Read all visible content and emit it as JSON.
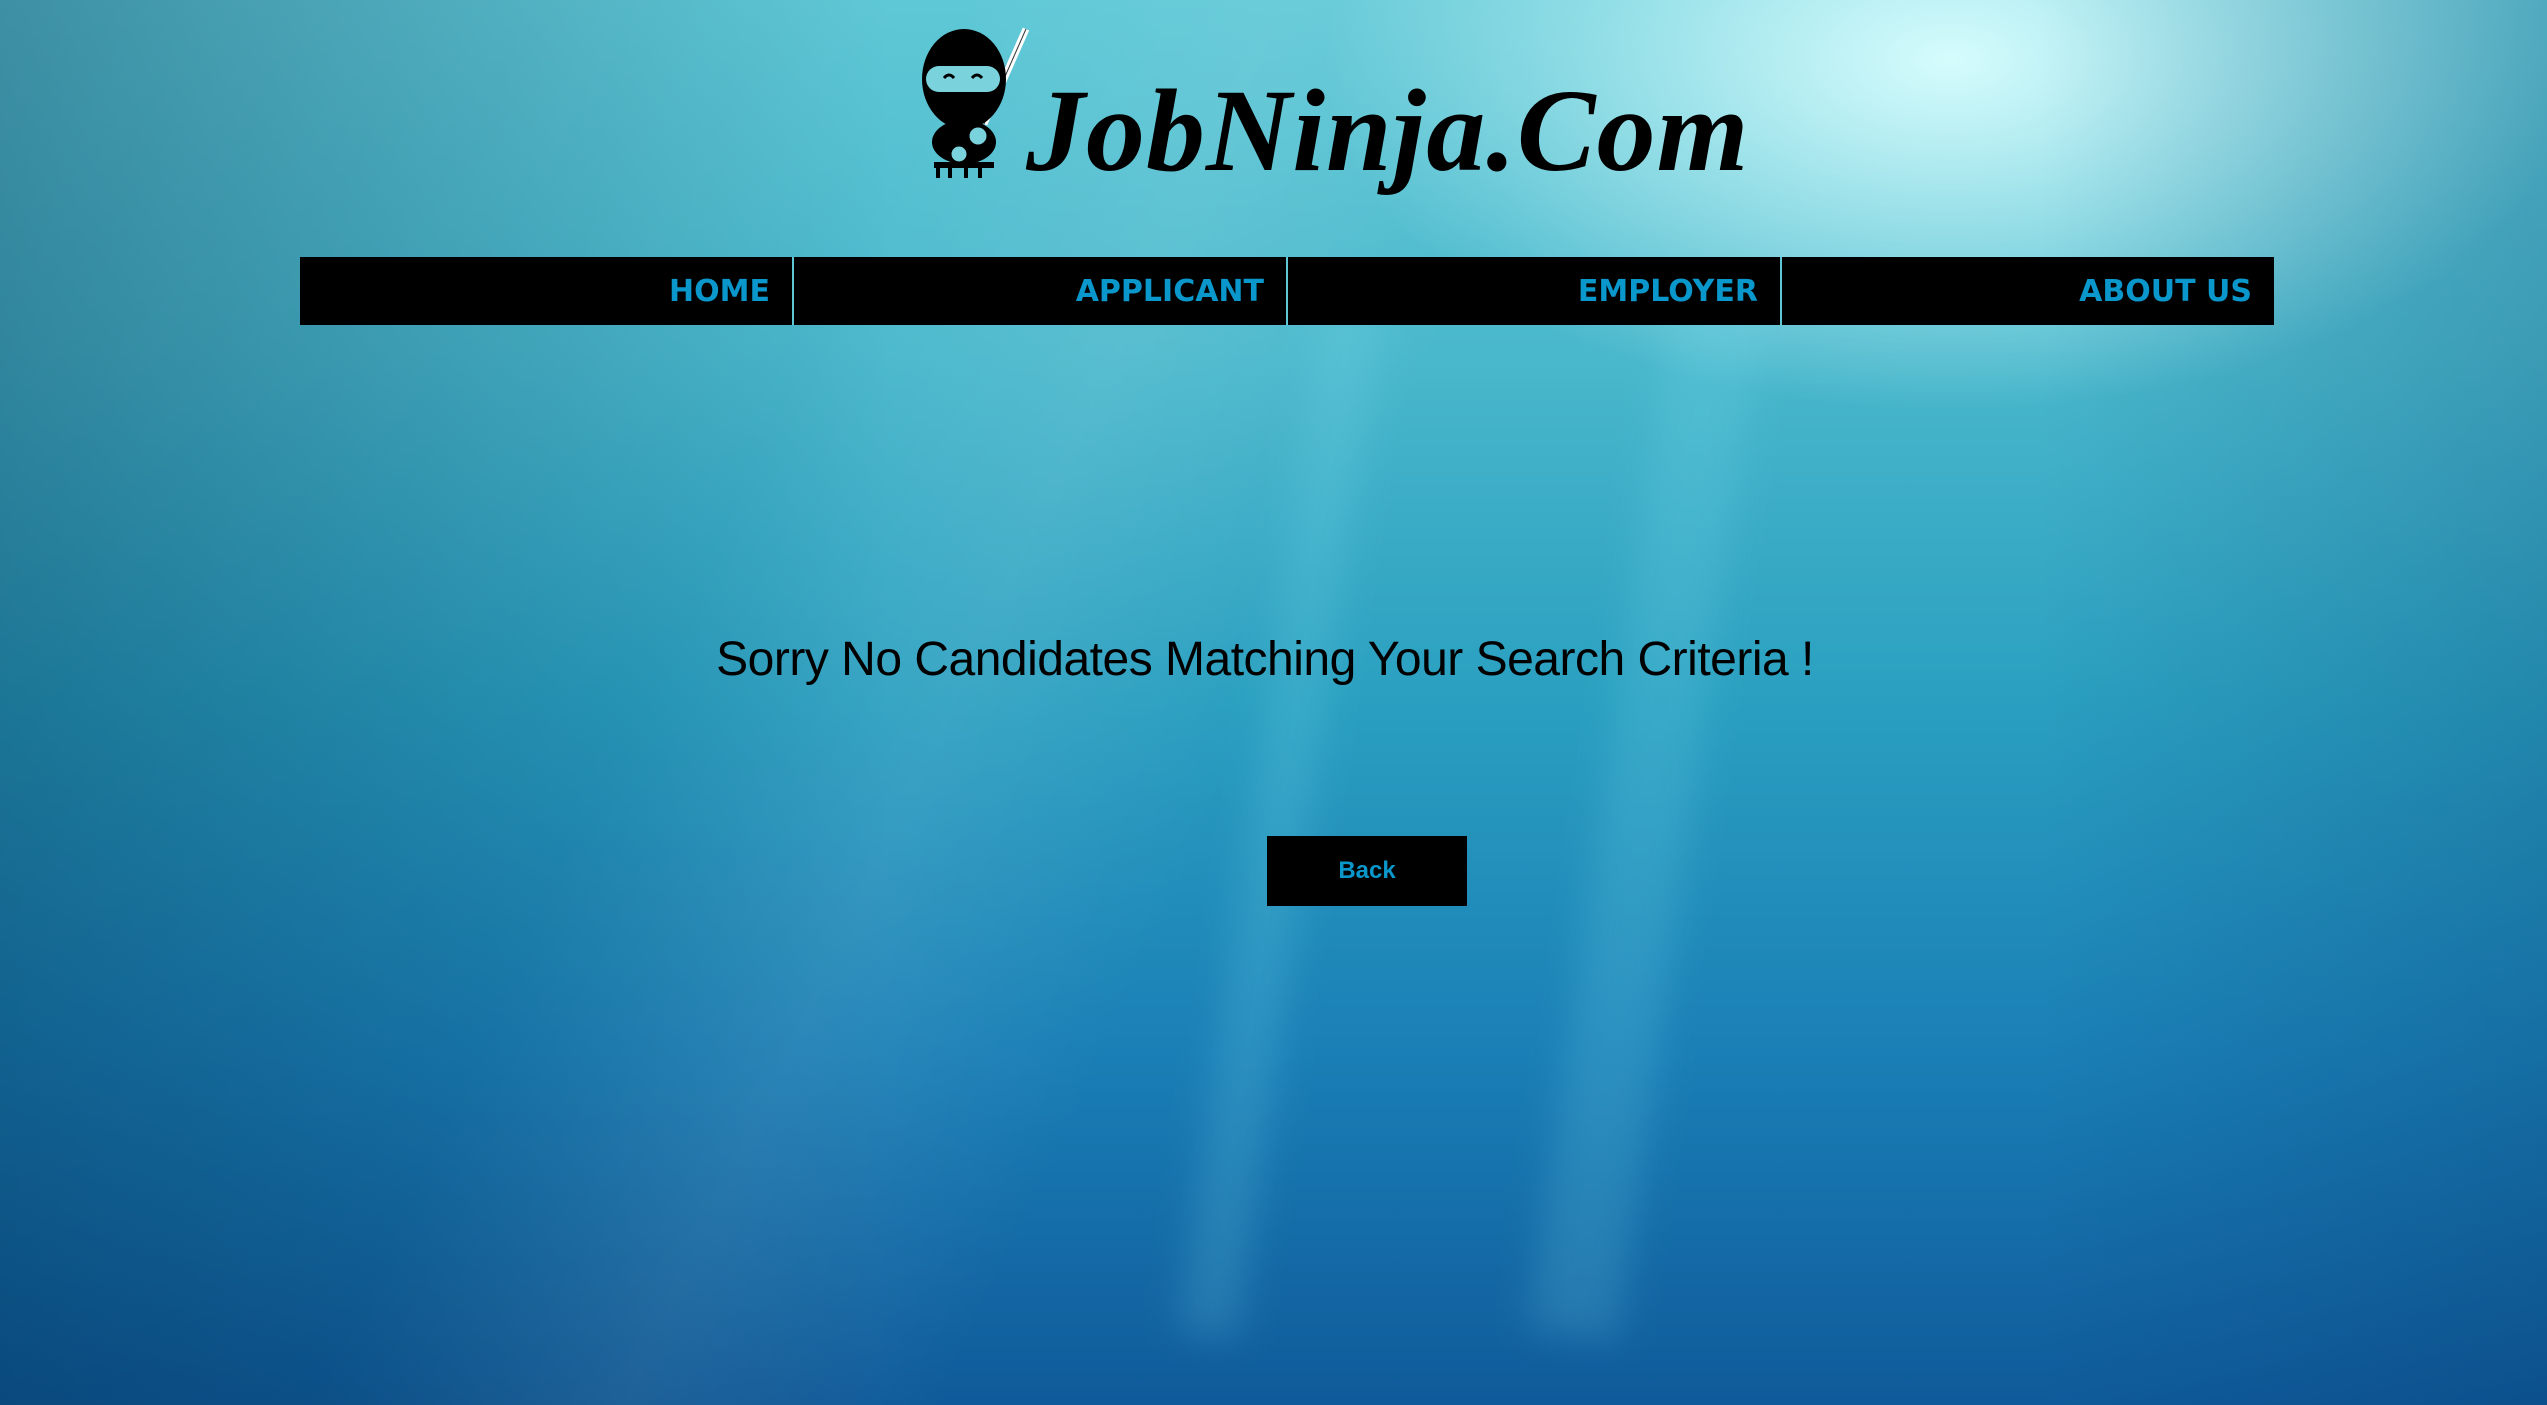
{
  "logo": {
    "text": "JobNinja.Com",
    "icon": "ninja-icon"
  },
  "nav": {
    "items": [
      {
        "label": "HOME"
      },
      {
        "label": "APPLICANT"
      },
      {
        "label": "EMPLOYER"
      },
      {
        "label": "ABOUT US"
      }
    ]
  },
  "main": {
    "message": "Sorry No Candidates Matching Your Search Criteria !",
    "back_label": "Back"
  },
  "colors": {
    "accent": "#0a97cc",
    "nav_bg": "#000000"
  }
}
